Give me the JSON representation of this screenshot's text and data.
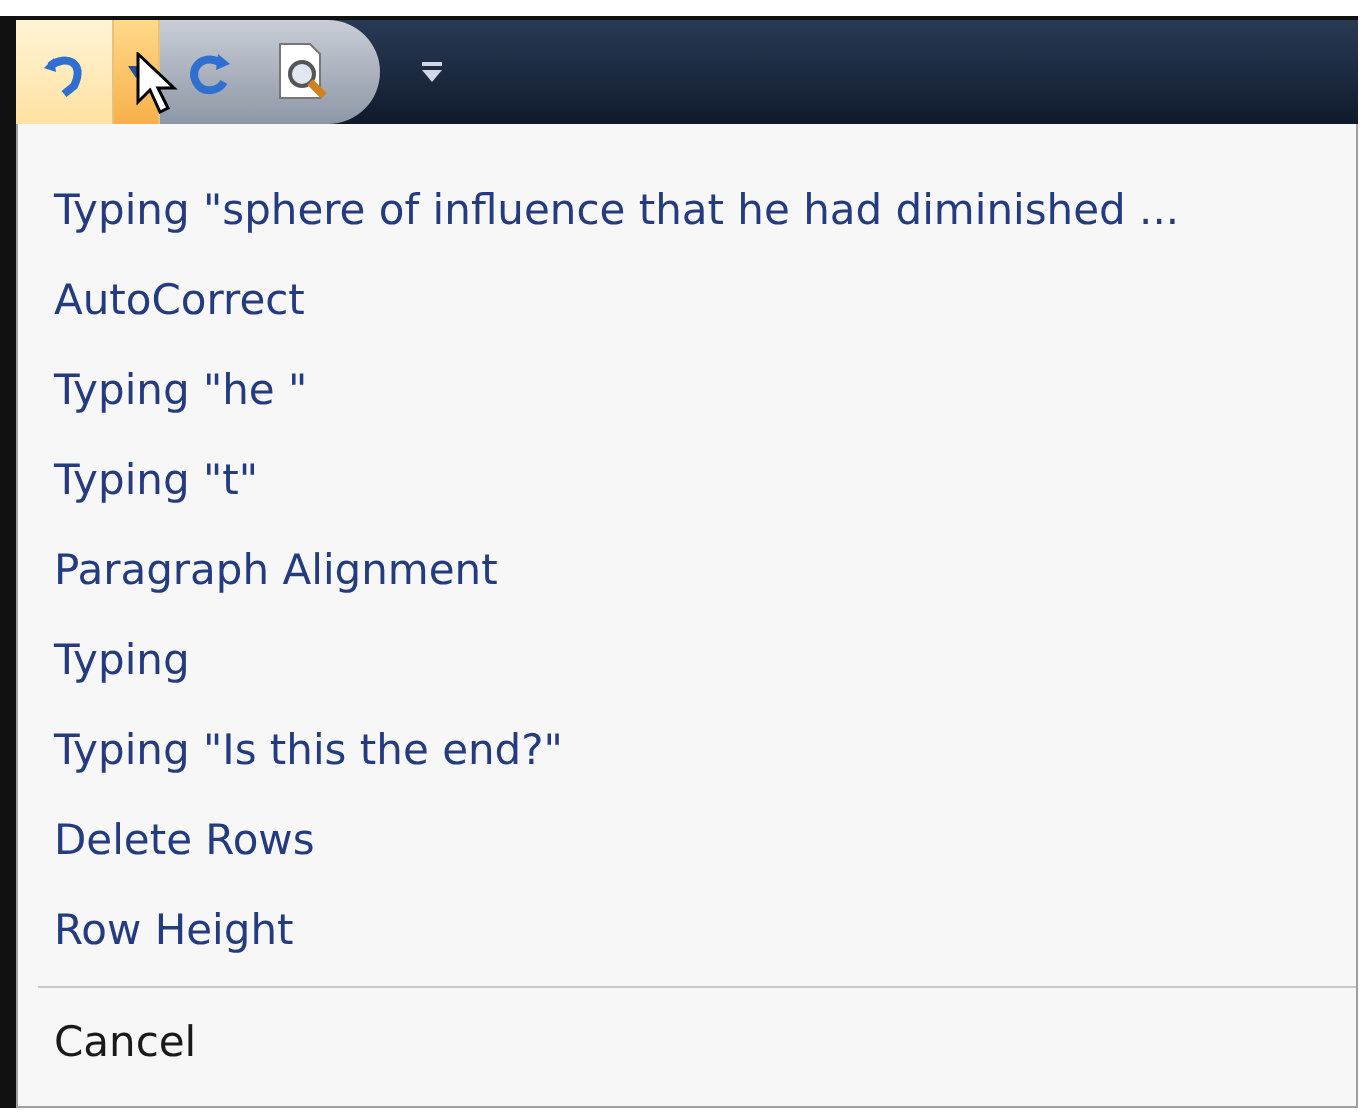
{
  "quick_access_toolbar": {
    "buttons": [
      {
        "kind": "undo",
        "highlighted": true
      },
      {
        "kind": "dropdown",
        "highlighted": true
      },
      {
        "kind": "redo",
        "highlighted": false
      },
      {
        "kind": "print-preview",
        "highlighted": false
      }
    ],
    "customize": {
      "kind": "customize"
    }
  },
  "undo_menu": {
    "items": [
      {
        "label": "Typing \"sphere of influence that he had diminished ..."
      },
      {
        "label": "AutoCorrect"
      },
      {
        "label": "Typing \"he \""
      },
      {
        "label": "Typing \"t\""
      },
      {
        "label": "Paragraph Alignment"
      },
      {
        "label": "Typing"
      },
      {
        "label": "Typing \"Is this the end?\""
      },
      {
        "label": "Delete Rows"
      },
      {
        "label": "Row Height"
      }
    ],
    "cancel": {
      "label": "Cancel"
    }
  }
}
